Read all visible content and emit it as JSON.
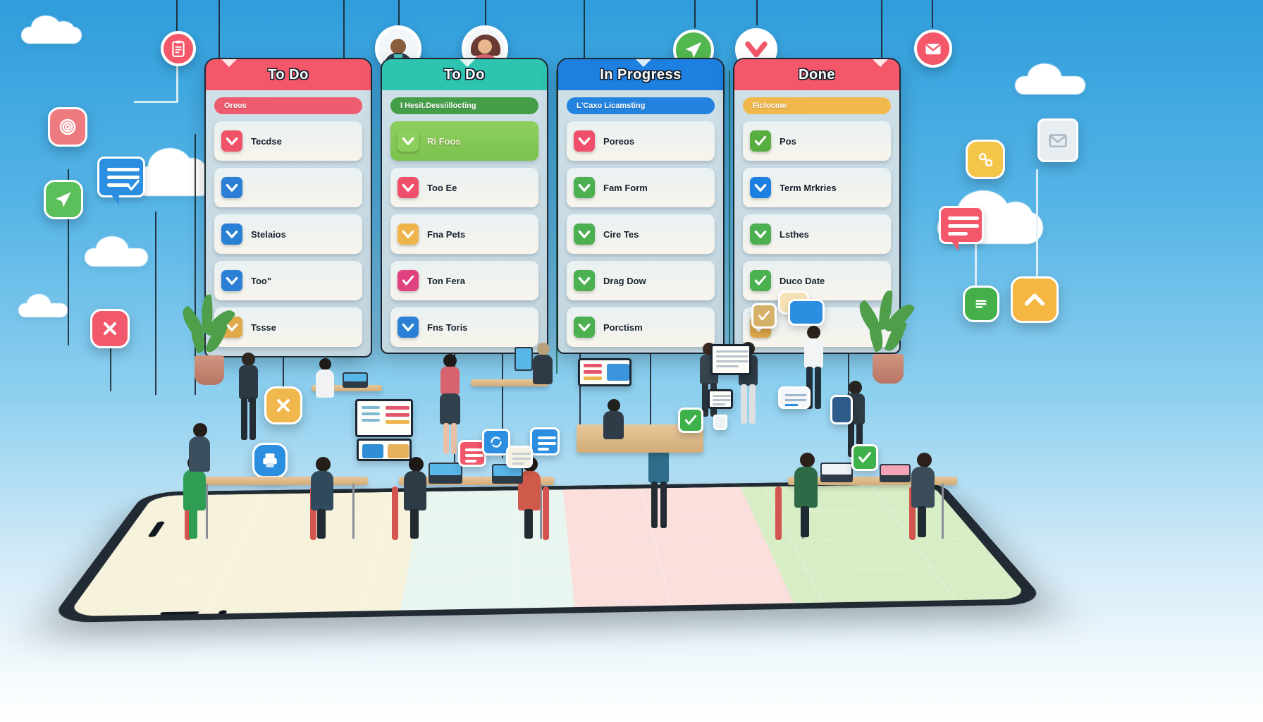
{
  "title": "Kanban Board Workflow Illustration",
  "board": {
    "columns": [
      {
        "id": "todo-red",
        "header": "To Do",
        "header_color": "#f4576a",
        "chip": {
          "label": "Oreos",
          "color": "#f05368"
        },
        "cards": [
          {
            "label": "Tecdse",
            "icon": "chevron-check-icon",
            "icon_color": "#f05368"
          },
          {
            "label": "",
            "icon": "chevron-check-icon",
            "icon_color": "#2b7fd4"
          },
          {
            "label": "Stelaios",
            "icon": "chevron-check-icon",
            "icon_color": "#2b7fd4"
          },
          {
            "label": "Too\"",
            "icon": "chevron-check-icon",
            "icon_color": "#2b7fd4"
          },
          {
            "label": "Tssse",
            "icon": "chevron-check-icon",
            "icon_color": "#e0a94a"
          }
        ]
      },
      {
        "id": "todo-teal",
        "header": "To Do",
        "header_color": "#2ec4b0",
        "chip": {
          "label": "I Hesit.Dessiillocting",
          "color": "#3d9b3f"
        },
        "cards": [
          {
            "label": "Ri Foos",
            "icon": "chevron-check-icon",
            "icon_color": "#8ccf5e",
            "highlight": true
          },
          {
            "label": "Too Ee",
            "icon": "chevron-check-icon",
            "icon_color": "#ef4f6b"
          },
          {
            "label": "Fna Pets",
            "icon": "chevron-check-icon",
            "icon_color": "#f0b44c"
          },
          {
            "label": "Ton Fera",
            "icon": "check-icon",
            "icon_color": "#e0417f"
          },
          {
            "label": "Fns Toris",
            "icon": "chevron-check-icon",
            "icon_color": "#2b7fd4"
          }
        ]
      },
      {
        "id": "in-progress",
        "header": "In Progress",
        "header_color": "#1d7fe0",
        "chip": {
          "label": "L'Caxo Licamsting",
          "color": "#1d7fe0"
        },
        "cards": [
          {
            "label": "Poreos",
            "icon": "chevron-check-icon",
            "icon_color": "#ef4f6b"
          },
          {
            "label": "Fam Form",
            "icon": "chevron-check-icon",
            "icon_color": "#4caf50"
          },
          {
            "label": "Cire Tes",
            "icon": "chevron-check-icon",
            "icon_color": "#4caf50"
          },
          {
            "label": "Drag Dow",
            "icon": "chevron-check-icon",
            "icon_color": "#4caf50"
          },
          {
            "label": "Porctism",
            "icon": "chevron-check-icon",
            "icon_color": "#4caf50"
          }
        ]
      },
      {
        "id": "done",
        "header": "Done",
        "header_color": "#f4576a",
        "chip": {
          "label": "Ficlocme",
          "color": "#f2b542"
        },
        "cards": [
          {
            "label": "Pos",
            "icon": "check-icon",
            "icon_color": "#58ae3f"
          },
          {
            "label": "Term Mrkries",
            "icon": "chevron-check-icon",
            "icon_color": "#1d7fe0"
          },
          {
            "label": "Lsthes",
            "icon": "chevron-check-icon",
            "icon_color": "#4caf50"
          },
          {
            "label": "Duco Date",
            "icon": "check-icon",
            "icon_color": "#4caf50"
          },
          {
            "label": "",
            "icon": "check-icon",
            "icon_color": "#e0a94a"
          }
        ]
      }
    ]
  },
  "floating": {
    "badges": [
      {
        "name": "clipboard-badge",
        "icon": "clipboard-icon",
        "color": "#f4576a"
      },
      {
        "name": "avatar-badge-left",
        "icon": "avatar-icon",
        "color": "#f4f7f9"
      },
      {
        "name": "avatar-badge-right",
        "icon": "avatar-icon",
        "color": "#f4f7f9"
      },
      {
        "name": "send-badge",
        "icon": "paper-plane-icon",
        "color": "#53b84f"
      },
      {
        "name": "check-badge",
        "icon": "chevron-check-icon",
        "color": "#f4576a"
      },
      {
        "name": "mail-badge",
        "icon": "envelope-icon",
        "color": "#f4576a"
      }
    ],
    "app_icons": [
      {
        "name": "spiral-icon",
        "color": "#ef7b80"
      },
      {
        "name": "paper-plane-icon",
        "color": "#5cc05a"
      },
      {
        "name": "chat-icon",
        "color": "#2b8ee0"
      },
      {
        "name": "close-icon",
        "color": "#f2596d"
      },
      {
        "name": "close-icon-amber",
        "color": "#f0b84c"
      },
      {
        "name": "printer-icon",
        "color": "#2b8ee0"
      },
      {
        "name": "settings-icon",
        "color": "#f3c64a"
      },
      {
        "name": "mail-icon",
        "color": "#e8edf2"
      },
      {
        "name": "chat-bubble-icon",
        "color": "#f4576a"
      },
      {
        "name": "list-icon",
        "color": "#45b04a"
      },
      {
        "name": "chevron-up-icon",
        "color": "#f5b642"
      }
    ],
    "pins": [
      {
        "name": "pin-check-amber",
        "color": "#f2c14e"
      },
      {
        "name": "pin-check-green",
        "color": "#5cae5a"
      },
      {
        "name": "pin-share-red",
        "color": "#f4576a"
      },
      {
        "name": "pin-down-red",
        "color": "#f4576a"
      },
      {
        "name": "pin-down-red-2",
        "color": "#f4576a"
      },
      {
        "name": "pin-target-red",
        "color": "#ec3f63"
      }
    ]
  },
  "device": {
    "name": "tablet-device",
    "floor_zones": [
      {
        "name": "zone-cream",
        "color": "#f7f2dc"
      },
      {
        "name": "zone-mint",
        "color": "#e6f4ef"
      },
      {
        "name": "zone-blush",
        "color": "#f9dcd9"
      },
      {
        "name": "zone-green",
        "color": "#d5ecc4"
      }
    ]
  }
}
